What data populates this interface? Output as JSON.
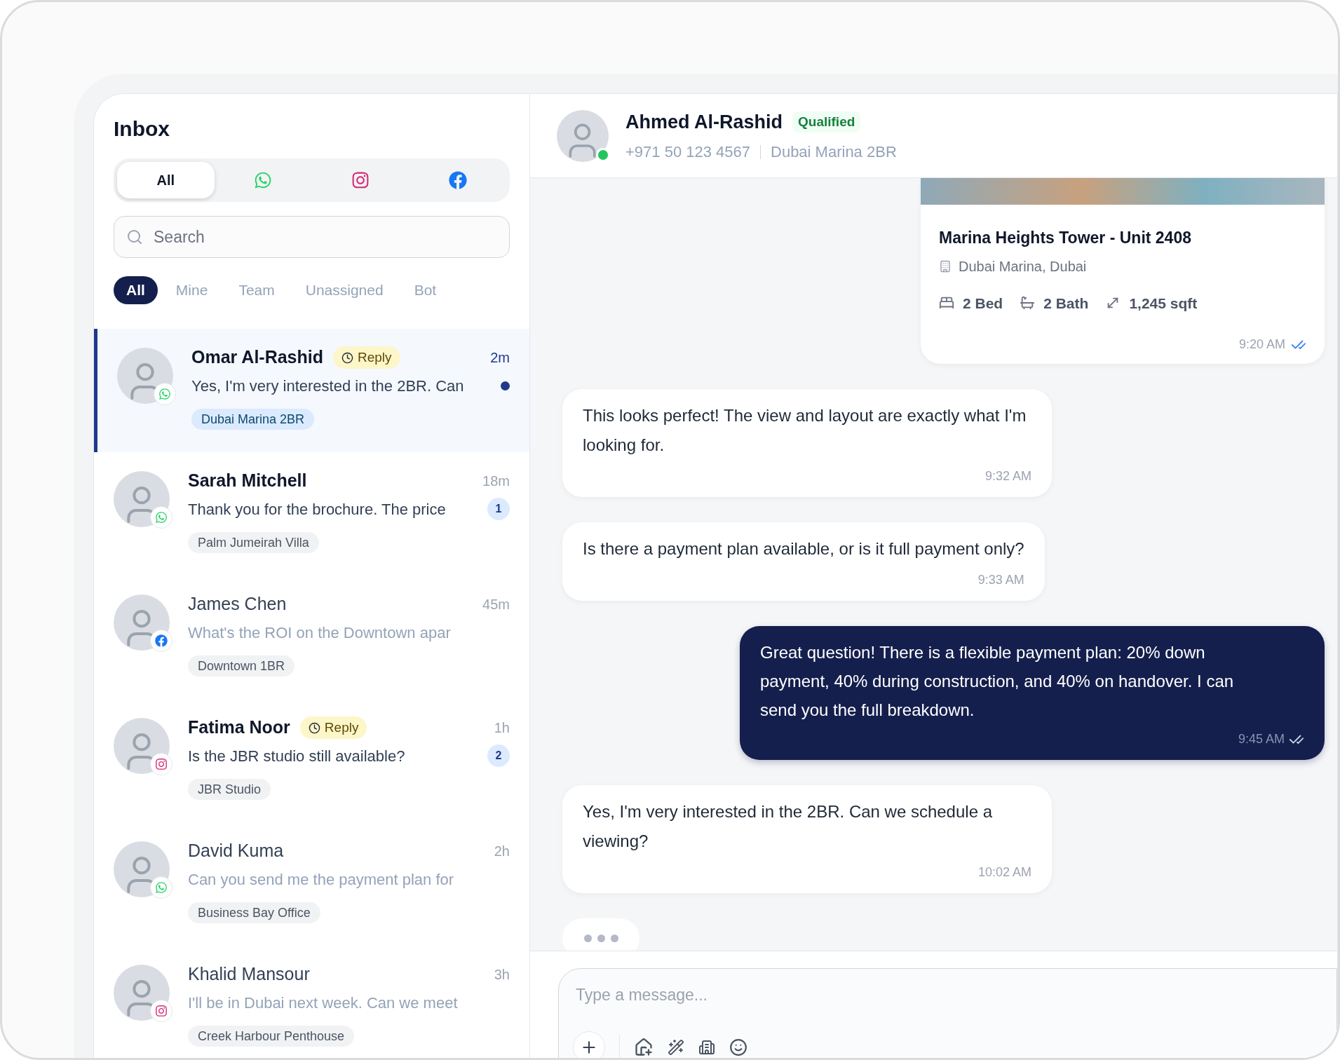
{
  "inbox": {
    "title": "Inbox",
    "channel_tabs": [
      {
        "kind": "all",
        "label": "All",
        "selected": true
      },
      {
        "kind": "whatsapp",
        "selected": false
      },
      {
        "kind": "instagram",
        "selected": false
      },
      {
        "kind": "facebook",
        "selected": false
      }
    ],
    "search": {
      "placeholder": "Search"
    },
    "filters": [
      {
        "label": "All",
        "selected": true
      },
      {
        "label": "Mine",
        "selected": false
      },
      {
        "label": "Team",
        "selected": false
      },
      {
        "label": "Unassigned",
        "selected": false
      },
      {
        "label": "Bot",
        "selected": false
      }
    ],
    "conversations": [
      {
        "name": "Omar Al-Rashid",
        "kind": "whatsapp",
        "badge": "Reply",
        "time": "2m",
        "preview": "Yes, I'm very interested in the 2BR. Can",
        "tag": "Dubai Marina 2BR",
        "unread": true,
        "selected": true
      },
      {
        "name": "Sarah Mitchell",
        "kind": "whatsapp",
        "time": "18m",
        "preview": "Thank you for the brochure. The price",
        "tag": "Palm Jumeirah Villa",
        "unread": true,
        "count": "1",
        "selected": false
      },
      {
        "name": "James Chen",
        "kind": "facebook",
        "time": "45m",
        "preview": "What's the ROI on the Downtown apar",
        "tag": "Downtown 1BR",
        "unread": false,
        "selected": false
      },
      {
        "name": "Fatima Noor",
        "kind": "instagram",
        "badge": "Reply",
        "time": "1h",
        "preview": "Is the JBR studio still available?",
        "tag": "JBR Studio",
        "unread": true,
        "count": "2",
        "selected": false
      },
      {
        "name": "David Kuma",
        "kind": "whatsapp",
        "time": "2h",
        "preview": "Can you send me the payment plan for",
        "tag": "Business Bay Office",
        "unread": false,
        "selected": false
      },
      {
        "name": "Khalid Mansour",
        "kind": "instagram",
        "time": "3h",
        "preview": "I'll be in Dubai next week. Can we meet",
        "tag": "Creek Harbour Penthouse",
        "unread": false,
        "selected": false
      }
    ]
  },
  "chat": {
    "contact": {
      "name": "Ahmed Al-Rashid",
      "status": "Qualified",
      "online": true,
      "phone": "+971 50 123 4567",
      "property": "Dubai Marina 2BR"
    },
    "messages": [
      {
        "kind": "listing",
        "title": "Marina Heights Tower - Unit 2408",
        "location": "Dubai Marina, Dubai",
        "beds": "2 Bed",
        "baths": "2 Bath",
        "area": "1,245 sqft",
        "time": "9:20 AM",
        "read": true
      },
      {
        "kind": "incoming",
        "text": "This looks perfect! The view and layout are exactly what I'm looking for.",
        "time": "9:32 AM"
      },
      {
        "kind": "incoming",
        "text": "Is there a payment plan available, or is it full payment only?",
        "time": "9:33 AM"
      },
      {
        "kind": "outgoing",
        "text": "Great question! There is a flexible payment plan: 20% down payment, 40% during construction, and 40% on handover. I can send you the full breakdown.",
        "time": "9:45 AM",
        "read": true
      },
      {
        "kind": "incoming",
        "text": "Yes, I'm very interested in the 2BR. Can we schedule a viewing?",
        "time": "10:02 AM"
      },
      {
        "kind": "typing"
      }
    ],
    "composer": {
      "placeholder": "Type a message..."
    }
  }
}
